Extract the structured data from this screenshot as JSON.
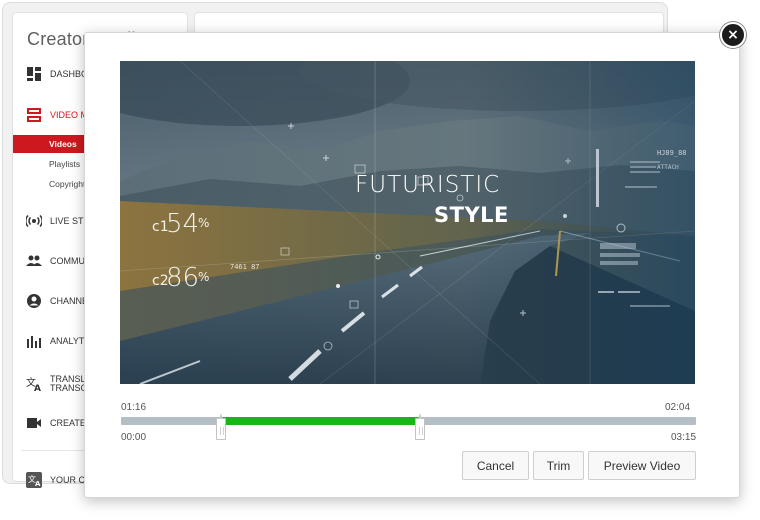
{
  "studio": {
    "title": "Creator Studio",
    "sidebar": {
      "items": [
        {
          "id": "dashboard",
          "label": "DASHBOARD",
          "icon": "dashboard-icon"
        },
        {
          "id": "video-manager",
          "label": "VIDEO MANAGER",
          "icon": "video-manager-icon",
          "color": "#cc181e"
        },
        {
          "id": "live",
          "label": "LIVE STREAMING",
          "icon": "live-icon"
        },
        {
          "id": "community",
          "label": "COMMUNITY",
          "icon": "community-icon"
        },
        {
          "id": "channel",
          "label": "CHANNEL",
          "icon": "channel-icon"
        },
        {
          "id": "analytics",
          "label": "ANALYTICS",
          "icon": "analytics-icon"
        },
        {
          "id": "translations",
          "label": "TRANSLATIONS & TRANSCRIPTIONS",
          "icon": "translate-icon"
        },
        {
          "id": "create",
          "label": "CREATE",
          "icon": "camera-icon"
        },
        {
          "id": "your-contributions",
          "label": "YOUR CONTRIBUTIONS",
          "icon": "translate-small-icon"
        }
      ],
      "sub_items": [
        "Videos",
        "Playlists",
        "Copyright"
      ]
    }
  },
  "video": {
    "title_line1": "FUTURISTIC",
    "title_line2": "STYLE",
    "overlay_c1": "c1",
    "overlay_c1_val": "54",
    "overlay_c2": "c2",
    "overlay_c2_val": "86",
    "overlay_pct": "%",
    "overlay_code": "7461 87",
    "overlay_hud_title": "HJ89_88",
    "overlay_hud_sub": "ATTACH"
  },
  "trim": {
    "start_time": "01:16",
    "end_time": "02:04",
    "min_time": "00:00",
    "max_time": "03:15",
    "selection_start_fraction": 0.176,
    "selection_end_fraction": 0.519,
    "selection_color": "#1db31d"
  },
  "buttons": {
    "cancel": "Cancel",
    "trim": "Trim",
    "preview": "Preview Video"
  },
  "close_icon": "close-icon"
}
